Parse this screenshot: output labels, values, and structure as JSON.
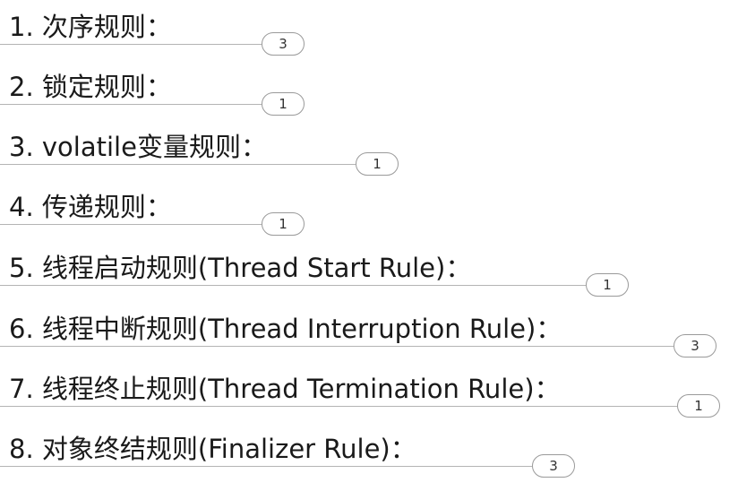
{
  "branches": [
    {
      "label": "1. 次序规则：",
      "count": "3"
    },
    {
      "label": "2. 锁定规则：",
      "count": "1"
    },
    {
      "label": "3. volatile变量规则：",
      "count": "1"
    },
    {
      "label": "4. 传递规则：",
      "count": "1"
    },
    {
      "label": "5. 线程启动规则(Thread Start Rule)：",
      "count": "1"
    },
    {
      "label": "6. 线程中断规则(Thread Interruption Rule)：",
      "count": "3"
    },
    {
      "label": "7. 线程终止规则(Thread Termination Rule)：",
      "count": "1"
    },
    {
      "label": "8. 对象终结规则(Finalizer Rule)：",
      "count": "3"
    }
  ]
}
